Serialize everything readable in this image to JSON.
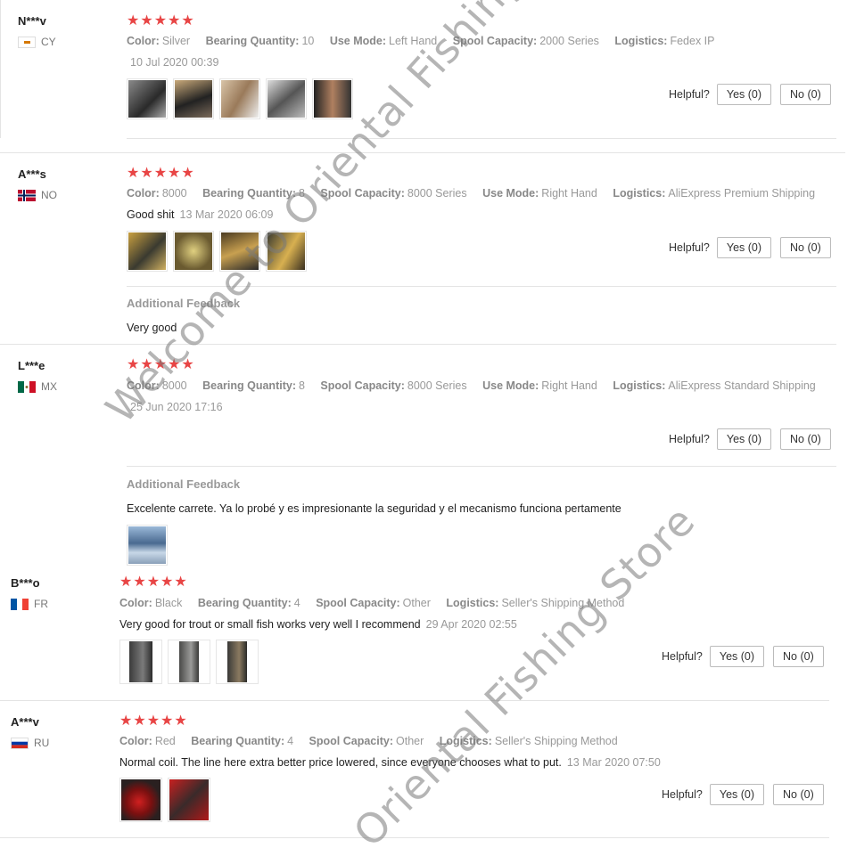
{
  "reviews": [
    {
      "user": "N***v",
      "country": "CY",
      "stars": "★★★★★",
      "attrs": [
        {
          "k": "Color:",
          "v": "Silver"
        },
        {
          "k": "Bearing Quantity:",
          "v": "10"
        },
        {
          "k": "Use Mode:",
          "v": "Left Hand"
        },
        {
          "k": "Spool Capacity:",
          "v": "2000 Series"
        },
        {
          "k": "Logistics:",
          "v": "Fedex IP"
        }
      ],
      "text": "",
      "date": "10 Jul 2020 00:39",
      "helpful_label": "Helpful?",
      "yes": "Yes (0)",
      "no": "No (0)"
    },
    {
      "user": "A***s",
      "country": "NO",
      "stars": "★★★★★",
      "attrs": [
        {
          "k": "Color:",
          "v": "8000"
        },
        {
          "k": "Bearing Quantity:",
          "v": "8"
        },
        {
          "k": "Spool Capacity:",
          "v": "8000 Series"
        },
        {
          "k": "Use Mode:",
          "v": "Right Hand"
        },
        {
          "k": "Logistics:",
          "v": "AliExpress Premium Shipping"
        }
      ],
      "text": "Good shit",
      "date": "13 Mar 2020 06:09",
      "helpful_label": "Helpful?",
      "yes": "Yes (0)",
      "no": "No (0)",
      "feedback_title": "Additional Feedback",
      "feedback_text": "Very good"
    },
    {
      "user": "L***e",
      "country": "MX",
      "stars": "★★★★★",
      "attrs": [
        {
          "k": "Color:",
          "v": "8000"
        },
        {
          "k": "Bearing Quantity:",
          "v": "8"
        },
        {
          "k": "Spool Capacity:",
          "v": "8000 Series"
        },
        {
          "k": "Use Mode:",
          "v": "Right Hand"
        },
        {
          "k": "Logistics:",
          "v": "AliExpress Standard Shipping"
        }
      ],
      "text": "",
      "date": "25 Jun 2020 17:16",
      "helpful_label": "Helpful?",
      "yes": "Yes (0)",
      "no": "No (0)",
      "feedback_title": "Additional Feedback",
      "feedback_text": "Excelente carrete. Ya lo probé y es impresionante la seguridad y el mecanismo funciona pertamente"
    },
    {
      "user": "B***o",
      "country": "FR",
      "stars": "★★★★★",
      "attrs": [
        {
          "k": "Color:",
          "v": "Black"
        },
        {
          "k": "Bearing Quantity:",
          "v": "4"
        },
        {
          "k": "Spool Capacity:",
          "v": "Other"
        },
        {
          "k": "Logistics:",
          "v": "Seller's Shipping Method"
        }
      ],
      "text": "Very good for trout or small fish works very well I recommend",
      "date": "29 Apr 2020 02:55",
      "helpful_label": "Helpful?",
      "yes": "Yes (0)",
      "no": "No (0)"
    },
    {
      "user": "A***v",
      "country": "RU",
      "stars": "★★★★★",
      "attrs": [
        {
          "k": "Color:",
          "v": "Red"
        },
        {
          "k": "Bearing Quantity:",
          "v": "4"
        },
        {
          "k": "Spool Capacity:",
          "v": "Other"
        },
        {
          "k": "Logistics:",
          "v": "Seller's Shipping Method"
        }
      ],
      "text": "Normal coil. The line here extra better price lowered, since everyone chooses what to put.",
      "date": "13 Mar 2020 07:50",
      "helpful_label": "Helpful?",
      "yes": "Yes (0)",
      "no": "No (0)"
    }
  ],
  "watermark": {
    "line1": "Welcome to Oriental Fishing",
    "line2": "Oriental Fishing Store"
  },
  "colors": {
    "star": "#e84545",
    "muted": "#999999"
  }
}
